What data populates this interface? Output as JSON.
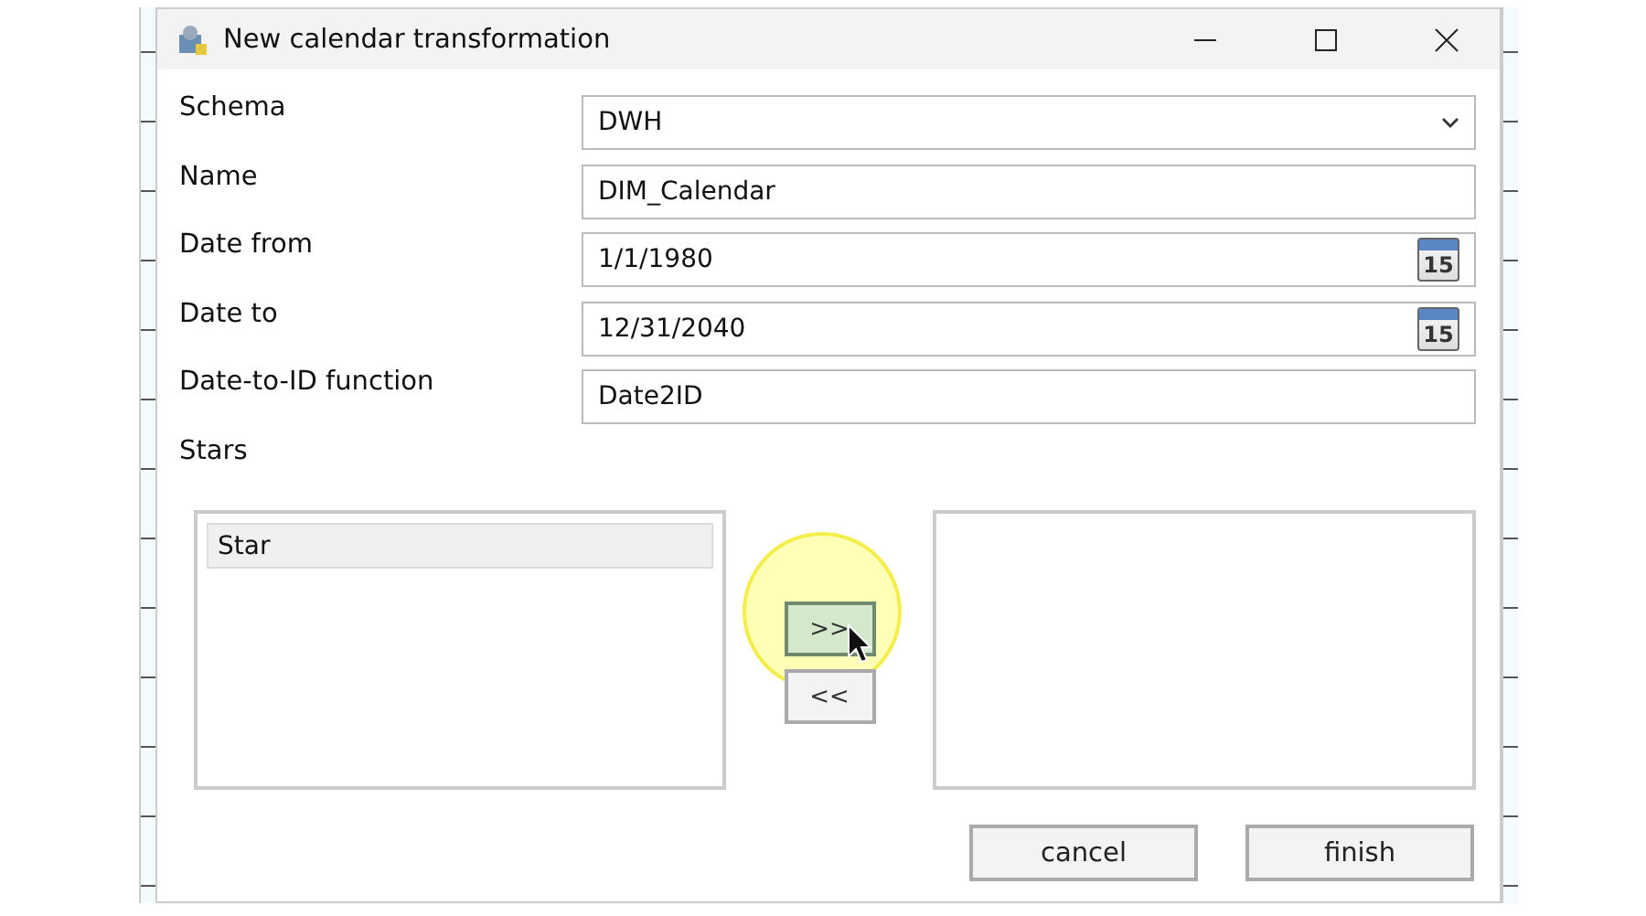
{
  "window": {
    "title": "New calendar transformation"
  },
  "fields": [
    {
      "label": "Schema",
      "kind": "dropdown",
      "value": "DWH"
    },
    {
      "label": "Name",
      "kind": "text",
      "value": "DIM_Calendar"
    },
    {
      "label": "Date from",
      "kind": "date",
      "value": "1/1/1980",
      "calendar_day": "15"
    },
    {
      "label": "Date to",
      "kind": "date",
      "value": "12/31/2040",
      "calendar_day": "15"
    },
    {
      "label": "Date-to-ID function",
      "kind": "text",
      "value": "Date2ID"
    }
  ],
  "stars": {
    "label": "Stars",
    "available": [
      {
        "label": "Star",
        "selected": true
      }
    ]
  },
  "move_buttons": [
    {
      "label": ">>",
      "hovered": true
    },
    {
      "label": "<<",
      "hovered": false
    }
  ],
  "buttons": [
    "cancel",
    "finish"
  ]
}
